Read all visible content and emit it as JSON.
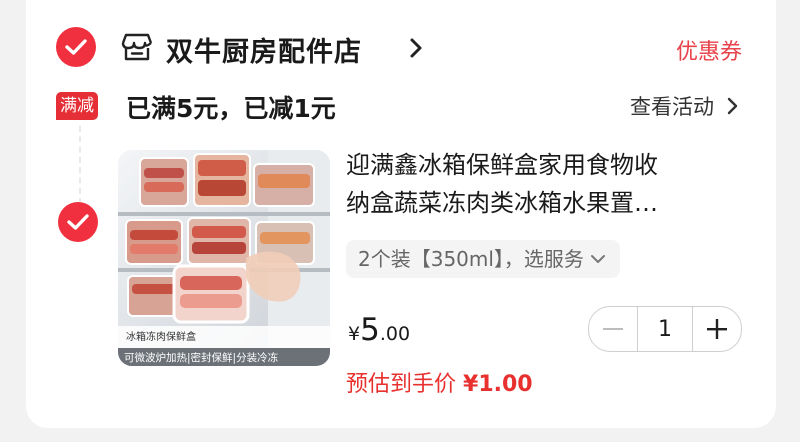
{
  "store": {
    "name": "双牛厨房配件店",
    "coupon_label": "优惠券"
  },
  "promo": {
    "badge": "满减",
    "text": "已满5元，已减1元",
    "view_activity": "查看活动"
  },
  "product": {
    "title_line1": "迎满鑫冰箱保鲜盒家用食物收",
    "title_line2": "纳盒蔬菜冻肉类冰箱水果置…",
    "variant": "2个装【350ml】，选服务",
    "price_currency": "¥",
    "price_integer": "5",
    "price_decimal": ".00",
    "estimate_label": "预估到手价",
    "estimate_amount": "¥1.00",
    "quantity": "1",
    "image_caption_1": "冰箱冻肉保鲜盒",
    "image_caption_2": "可微波炉加热|密封保鲜|分装冷冻"
  },
  "colors": {
    "accent_red": "#f0303f",
    "price_red": "#e8302f",
    "coupon_red": "#e8424a"
  },
  "icons": {
    "store": "store-icon",
    "check": "checkmark-circle-icon",
    "chevron": "chevron-right-icon",
    "dropdown": "chevron-down-icon",
    "minus": "minus-icon",
    "plus": "plus-icon"
  }
}
